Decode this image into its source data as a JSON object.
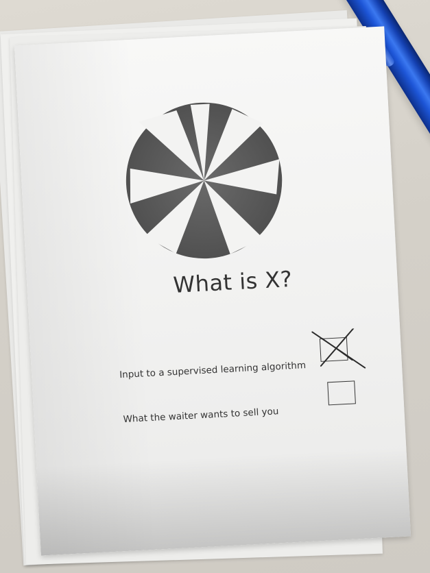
{
  "card": {
    "title": "What is X?",
    "options": [
      {
        "label": "Input to a supervised learning algorithm",
        "checked": true
      },
      {
        "label": "What the waiter wants to sell you",
        "checked": false
      }
    ]
  },
  "icons": {
    "logo": "pinwheel-logo-icon",
    "pen": "blue-pen"
  },
  "colors": {
    "paper": "#f4f4f3",
    "ink": "#333333",
    "pen": "#1d55d6",
    "logo": "#5a5a5a"
  }
}
